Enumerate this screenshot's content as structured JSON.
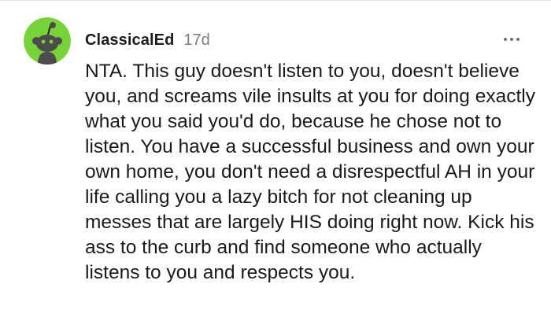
{
  "comment": {
    "username": "ClassicalEd",
    "timestamp": "17d",
    "body": "NTA. This guy doesn't listen to you, doesn't believe you, and screams vile insults at you for doing exactly what you said you'd do, because he chose not to listen. You have a successful business and own your own home, you don't need a disrespectful AH in your life calling you a lazy bitch for not cleaning up messes that are largely HIS doing right now. Kick his ass to the curb and find someone who actually listens to you and respects you.",
    "avatar_icon": "snoo-avatar-icon",
    "avatar_color": "#78d33b",
    "more_icon": "more-options-icon"
  }
}
